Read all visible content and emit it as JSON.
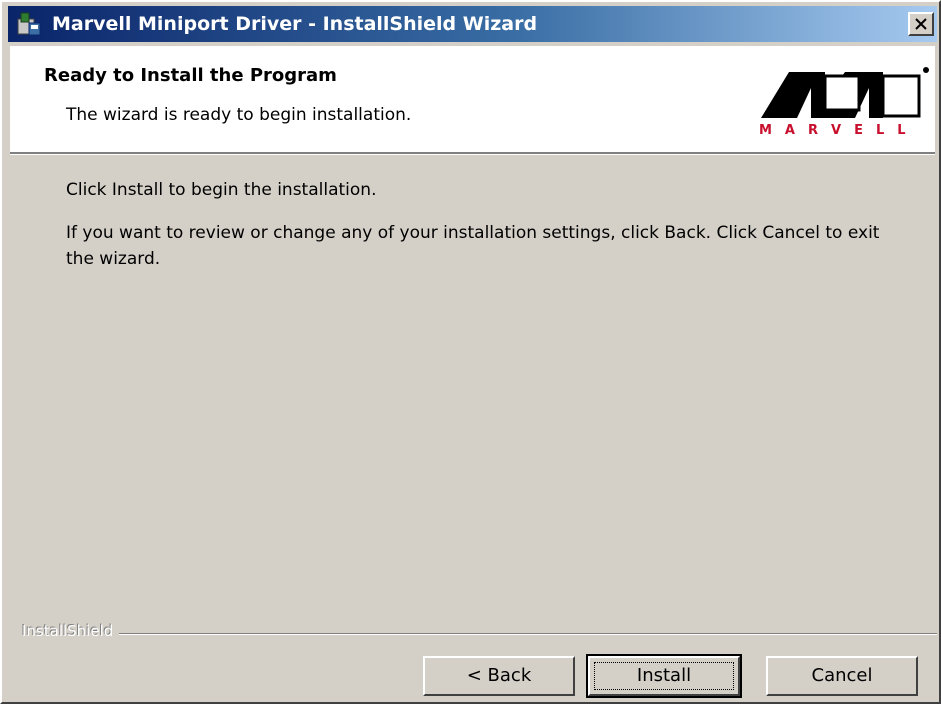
{
  "window": {
    "title": "Marvell Miniport Driver - InstallShield Wizard",
    "app_icon": "installer-icon",
    "close_icon": "close-icon"
  },
  "header": {
    "title": "Ready to Install the Program",
    "subtitle": "The wizard is ready to begin installation.",
    "logo_text": "MARVELL",
    "logo_icon": "marvell-logo",
    "brand_color": "#c8102e"
  },
  "body": {
    "line1": "Click Install to begin the installation.",
    "line2": "If you want to review or change any of your installation settings, click Back. Click Cancel to exit the wizard."
  },
  "footer": {
    "brand": "InstallShield"
  },
  "buttons": {
    "back": "< Back",
    "install": "Install",
    "cancel": "Cancel"
  },
  "colors": {
    "titlebar_start": "#0a246a",
    "titlebar_end": "#a6caf0",
    "face": "#d4d0c8"
  }
}
